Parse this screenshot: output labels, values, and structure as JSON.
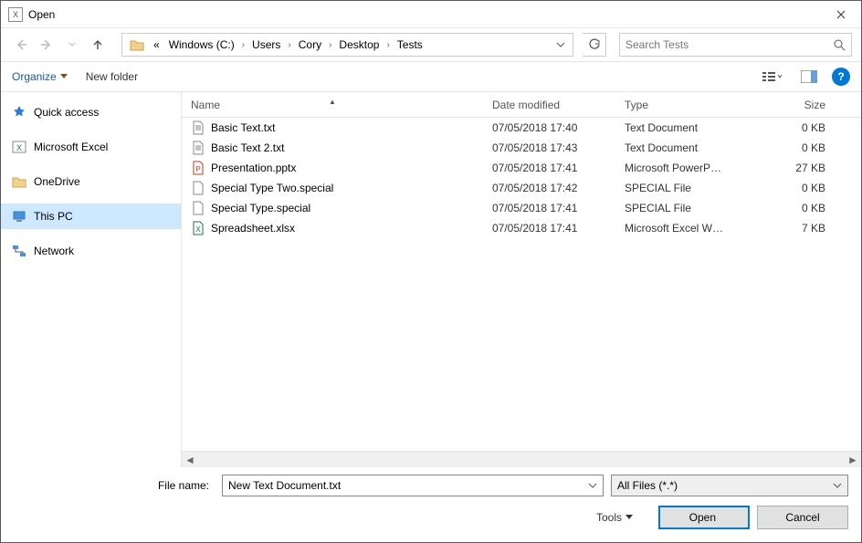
{
  "window": {
    "title": "Open"
  },
  "breadcrumb": {
    "root_glyph": "«",
    "segments": [
      "Windows (C:)",
      "Users",
      "Cory",
      "Desktop",
      "Tests"
    ]
  },
  "search": {
    "placeholder": "Search Tests"
  },
  "toolbar": {
    "organize": "Organize",
    "new_folder": "New folder"
  },
  "sidebar": {
    "items": [
      {
        "label": "Quick access",
        "icon": "star-icon",
        "color": "#2e7cd6"
      },
      {
        "label": "Microsoft Excel",
        "icon": "excel-icon",
        "color": "#217346"
      },
      {
        "label": "OneDrive",
        "icon": "folder-icon",
        "color": "#f3d38b"
      },
      {
        "label": "This PC",
        "icon": "pc-icon",
        "color": "#2e7cd6",
        "selected": true
      },
      {
        "label": "Network",
        "icon": "network-icon",
        "color": "#2e7cd6"
      }
    ]
  },
  "columns": {
    "name": "Name",
    "date": "Date modified",
    "type": "Type",
    "size": "Size"
  },
  "files": [
    {
      "name": "Basic Text.txt",
      "date": "07/05/2018 17:40",
      "type": "Text Document",
      "size": "0 KB",
      "icon": "text-file-icon"
    },
    {
      "name": "Basic Text 2.txt",
      "date": "07/05/2018 17:43",
      "type": "Text Document",
      "size": "0 KB",
      "icon": "text-file-icon"
    },
    {
      "name": "Presentation.pptx",
      "date": "07/05/2018 17:41",
      "type": "Microsoft PowerP…",
      "size": "27 KB",
      "icon": "powerpoint-file-icon"
    },
    {
      "name": "Special Type Two.special",
      "date": "07/05/2018 17:42",
      "type": "SPECIAL File",
      "size": "0 KB",
      "icon": "generic-file-icon"
    },
    {
      "name": "Special Type.special",
      "date": "07/05/2018 17:41",
      "type": "SPECIAL File",
      "size": "0 KB",
      "icon": "generic-file-icon"
    },
    {
      "name": "Spreadsheet.xlsx",
      "date": "07/05/2018 17:41",
      "type": "Microsoft Excel W…",
      "size": "7 KB",
      "icon": "excel-file-icon"
    }
  ],
  "footer": {
    "filename_label": "File name:",
    "filename_value": "New Text Document.txt",
    "filter": "All Files (*.*)",
    "tools": "Tools",
    "open": "Open",
    "cancel": "Cancel"
  }
}
